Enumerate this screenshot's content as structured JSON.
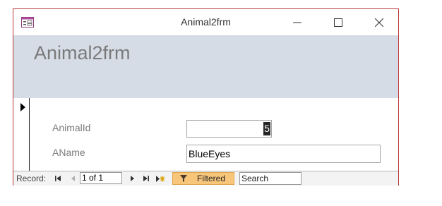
{
  "window": {
    "title": "Animal2frm",
    "icons": {
      "form": "form-icon",
      "minimize": "minimize-icon",
      "maximize": "maximize-icon",
      "close": "close-icon"
    }
  },
  "header": {
    "title": "Animal2frm"
  },
  "form": {
    "fields": [
      {
        "label": "AnimalId",
        "value": "5"
      },
      {
        "label": "AName",
        "value": "BlueEyes"
      }
    ]
  },
  "navbar": {
    "record_label": "Record:",
    "position": "1 of 1",
    "filter_label": "Filtered",
    "search_placeholder": "Search",
    "filter_color": "#f8c67b"
  },
  "colors": {
    "window_border": "#b9383a",
    "header_bg": "#d6dce5"
  }
}
